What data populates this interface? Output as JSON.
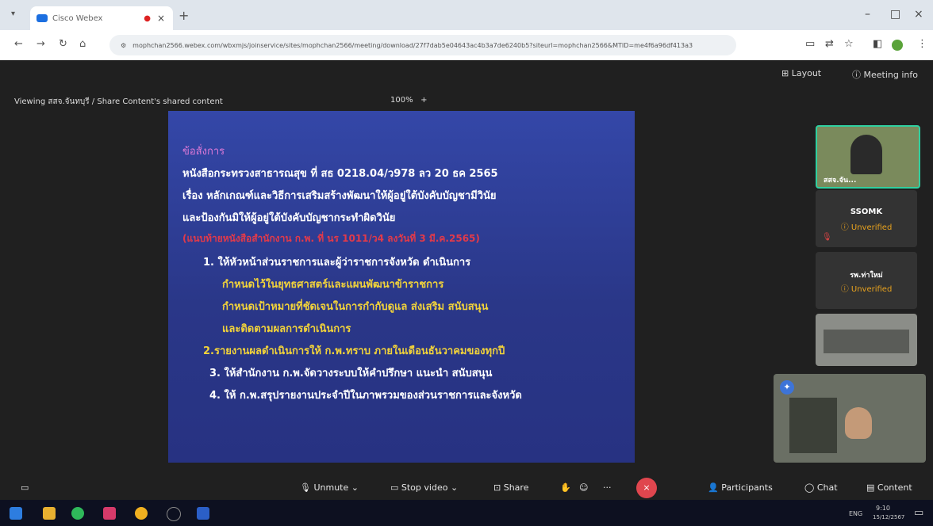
{
  "browser": {
    "tab_title": "Cisco Webex",
    "url": "mophchan2566.webex.com/wbxmjs/joinservice/sites/mophchan2566/meeting/download/27f7dab5e04643ac4b3a7de6240b5?siteurl=mophchan2566&MTID=me4f6a96df413a3",
    "new_tab": "+"
  },
  "meeting": {
    "viewing_label": "Viewing สสจ.จันทบุรี / Share Content's shared content",
    "zoom_level": "100%",
    "layout_label": "Layout",
    "meeting_info_label": "Meeting info"
  },
  "slide": {
    "heading": "ข้อสั่งการ",
    "line1": "หนังสือกระทรวงสาธารณสุข ที่ สธ 0218.04/ว978 ลว 20 ธค 2565",
    "line2": "เรื่อง หลักเกณฑ์และวิธีการเสริมสร้างพัฒนาให้ผู้อยู่ใต้บังคับบัญชามีวินัย",
    "line3": "และป้องกันมิให้ผู้อยู่ใต้บังคับบัญชากระทำผิดวินัย",
    "line4_red": "(แนบท้ายหนังสือสำนักงาน ก.พ. ที่ นร 1011/ว4 ลงวันที่ 3 มี.ค.2565)",
    "item1a": "1. ให้หัวหน้าส่วนราชการและผู้ว่าราชการจังหวัด ดำเนินการ",
    "item1b": "กำหนดไว้ในยุทธศาสตร์และแผนพัฒนาข้าราชการ",
    "item1c": "กำหนดเป้าหมายที่ชัดเจนในการกำกับดูแล ส่งเสริม สนับสนุน",
    "item1d": "และติดตามผลการดำเนินการ",
    "item2": "2.รายงานผลดำเนินการให้ ก.พ.ทราบ ภายในเดือนธันวาคมของทุกปี",
    "item3": "3. ให้สำนักงาน ก.พ.จัดวางระบบให้คำปรึกษา แนะนำ สนับสนุน",
    "item4": "4. ให้ ก.พ.สรุปรายงานประจำปีในภาพรวมของส่วนราชการและจังหวัด"
  },
  "participants": [
    {
      "name": "สสจ.จัน...",
      "status": ""
    },
    {
      "name": "SSOMK",
      "status": "Unverified"
    },
    {
      "name": "รพ.ท่าใหม่",
      "status": "Unverified"
    },
    {
      "name": "",
      "status": ""
    }
  ],
  "controls": {
    "unmute": "Unmute",
    "stop_video": "Stop video",
    "share": "Share",
    "more": "···",
    "participants": "Participants",
    "chat": "Chat",
    "content": "Content"
  },
  "taskbar": {
    "time": "9:10",
    "date": "15/12/2567",
    "lang": "ENG"
  },
  "colors": {
    "slide_bg": "#2b3a8e",
    "heading": "#e07ad8",
    "white_text": "#ffffff",
    "yellow_text": "#f2d33a",
    "red_text": "#e23a4a",
    "unverified": "#e8a21e",
    "leave_button": "#e0464e"
  }
}
